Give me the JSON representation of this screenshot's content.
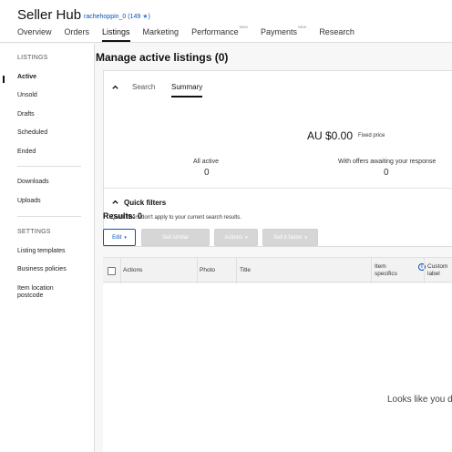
{
  "header": {
    "brand": "Seller Hub",
    "user": "rachehoppin_0",
    "feedback": "(149",
    "star": "★",
    "feedback_close": ")",
    "nav": [
      {
        "label": "Overview",
        "badge": ""
      },
      {
        "label": "Orders",
        "badge": ""
      },
      {
        "label": "Listings",
        "badge": ""
      },
      {
        "label": "Marketing",
        "badge": ""
      },
      {
        "label": "Performance",
        "badge": "NEW"
      },
      {
        "label": "Payments",
        "badge": "NEW"
      },
      {
        "label": "Research",
        "badge": ""
      }
    ]
  },
  "sidebar": {
    "listings_heading": "LISTINGS",
    "items": [
      "Active",
      "Unsold",
      "Drafts",
      "Scheduled",
      "Ended",
      "Downloads",
      "Uploads"
    ],
    "settings_heading": "SETTINGS",
    "settings_items": [
      "Listing templates",
      "Business policies",
      "Item location\npostcode"
    ]
  },
  "main": {
    "title": "Manage active listings (0)",
    "tabs": [
      "Search",
      "Summary"
    ],
    "amount": "AU $0.00",
    "amount_sub": "Fixed price",
    "stats": [
      {
        "label": "All active",
        "value": "0"
      },
      {
        "label": "With offers awaiting your response",
        "value": "0"
      }
    ],
    "quick_filters_title": "Quick filters",
    "quick_filters_note": "Quick filters don't apply to your current search results.",
    "results": "Results: 0",
    "toolbar": {
      "edit": "Edit",
      "sell_similar": "Sell similar",
      "actions": "Actions",
      "sell_faster": "Sell it faster"
    },
    "columns": [
      "Actions",
      "Photo",
      "Title",
      "Item\nspecifics",
      "Custom\nlabel"
    ],
    "empty_text": "Looks like you d"
  },
  "colors": {
    "link": "#0654ba",
    "disabled": "#d6d6d6"
  },
  "icons": {
    "caret_up": "chevron-up-icon",
    "caret_down": "chevron-down-icon",
    "info": "info-icon",
    "star": "star-icon"
  }
}
